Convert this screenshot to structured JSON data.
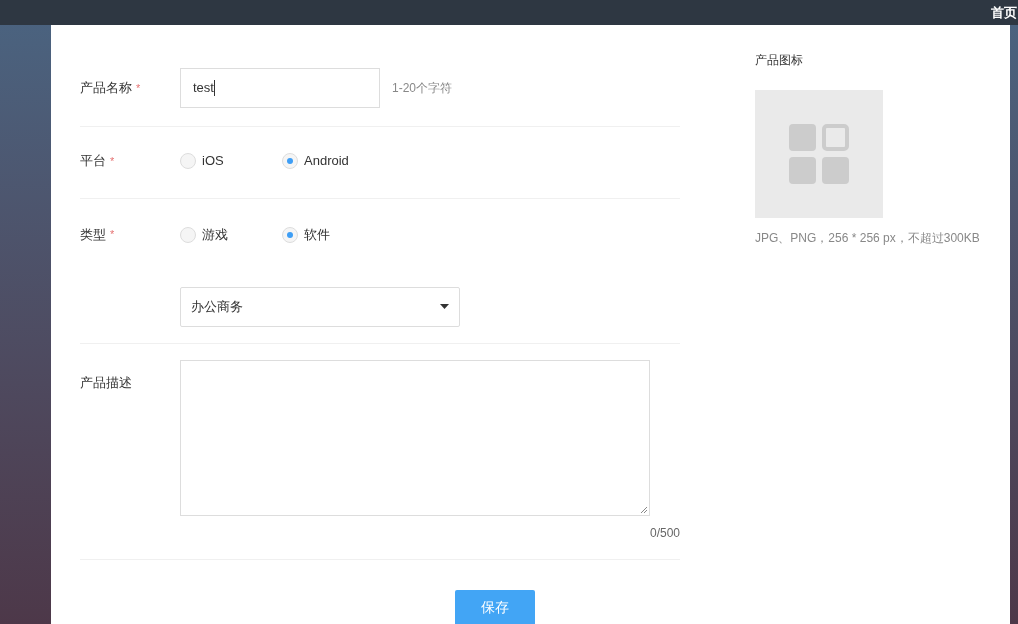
{
  "top_bar": {
    "home_link": "首页"
  },
  "form": {
    "name_field": {
      "label": "产品名称",
      "required_mark": "*",
      "value": "test",
      "hint": "1-20个字符"
    },
    "platform": {
      "label": "平台",
      "required_mark": "*",
      "options": [
        {
          "label": "iOS",
          "selected": false
        },
        {
          "label": "Android",
          "selected": true
        }
      ]
    },
    "type": {
      "label": "类型",
      "required_mark": "*",
      "options": [
        {
          "label": "游戏",
          "selected": false
        },
        {
          "label": "软件",
          "selected": true
        }
      ],
      "category_select": {
        "value": "办公商务"
      }
    },
    "description": {
      "label": "产品描述",
      "counter": "0/500"
    },
    "save_button": "保存"
  },
  "icon_panel": {
    "title": "产品图标",
    "hint": "JPG、PNG，256 * 256 px，不超过300KB"
  }
}
